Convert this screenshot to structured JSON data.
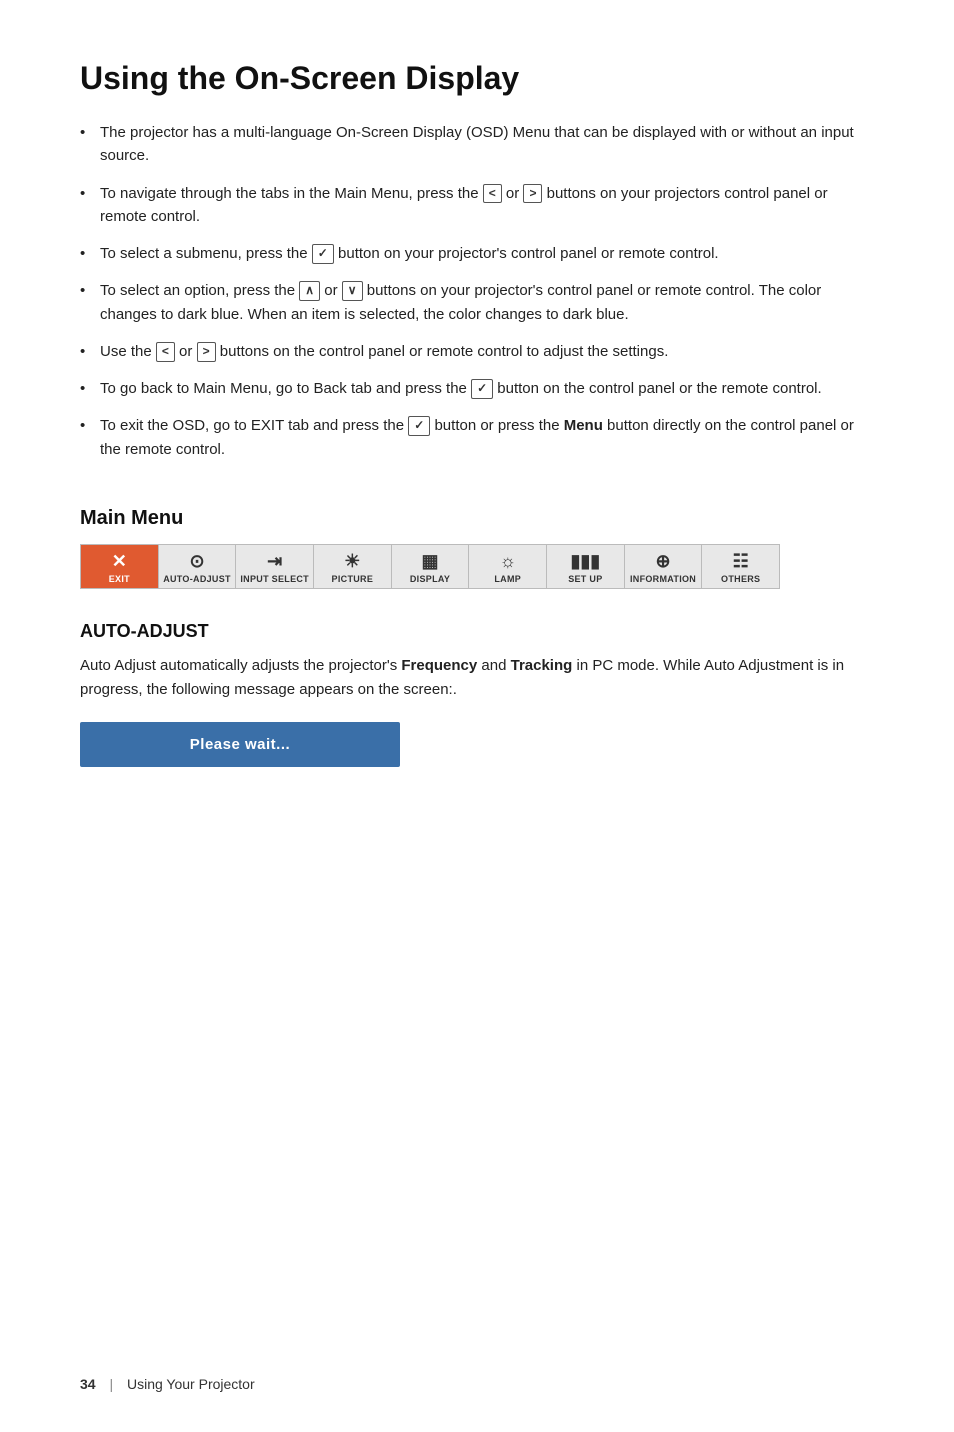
{
  "page": {
    "title": "Using the On-Screen Display"
  },
  "bullets": [
    "The projector has a multi-language On-Screen Display (OSD) Menu that can be displayed with or without an input source."
  ],
  "mainMenu": {
    "heading": "Main Menu",
    "items": [
      {
        "label": "EXIT"
      },
      {
        "label": "AUTO-ADJUST"
      },
      {
        "label": "INPUT SELECT"
      },
      {
        "label": "PICTURE"
      },
      {
        "label": "DISPLAY"
      },
      {
        "label": "LAMP"
      },
      {
        "label": "SET UP"
      },
      {
        "label": "INFORMATION"
      },
      {
        "label": "OTHERS"
      }
    ]
  },
  "autoAdjust": {
    "heading": "AUTO-ADJUST",
    "description": "Auto Adjust automatically adjusts the projector's Frequency and Tracking in PC mode. While Auto Adjustment is in progress, the following message appears on the screen:.",
    "waitMessage": "Please wait..."
  },
  "footer": {
    "pageNumber": "34",
    "sectionLabel": "Using Your Projector"
  }
}
